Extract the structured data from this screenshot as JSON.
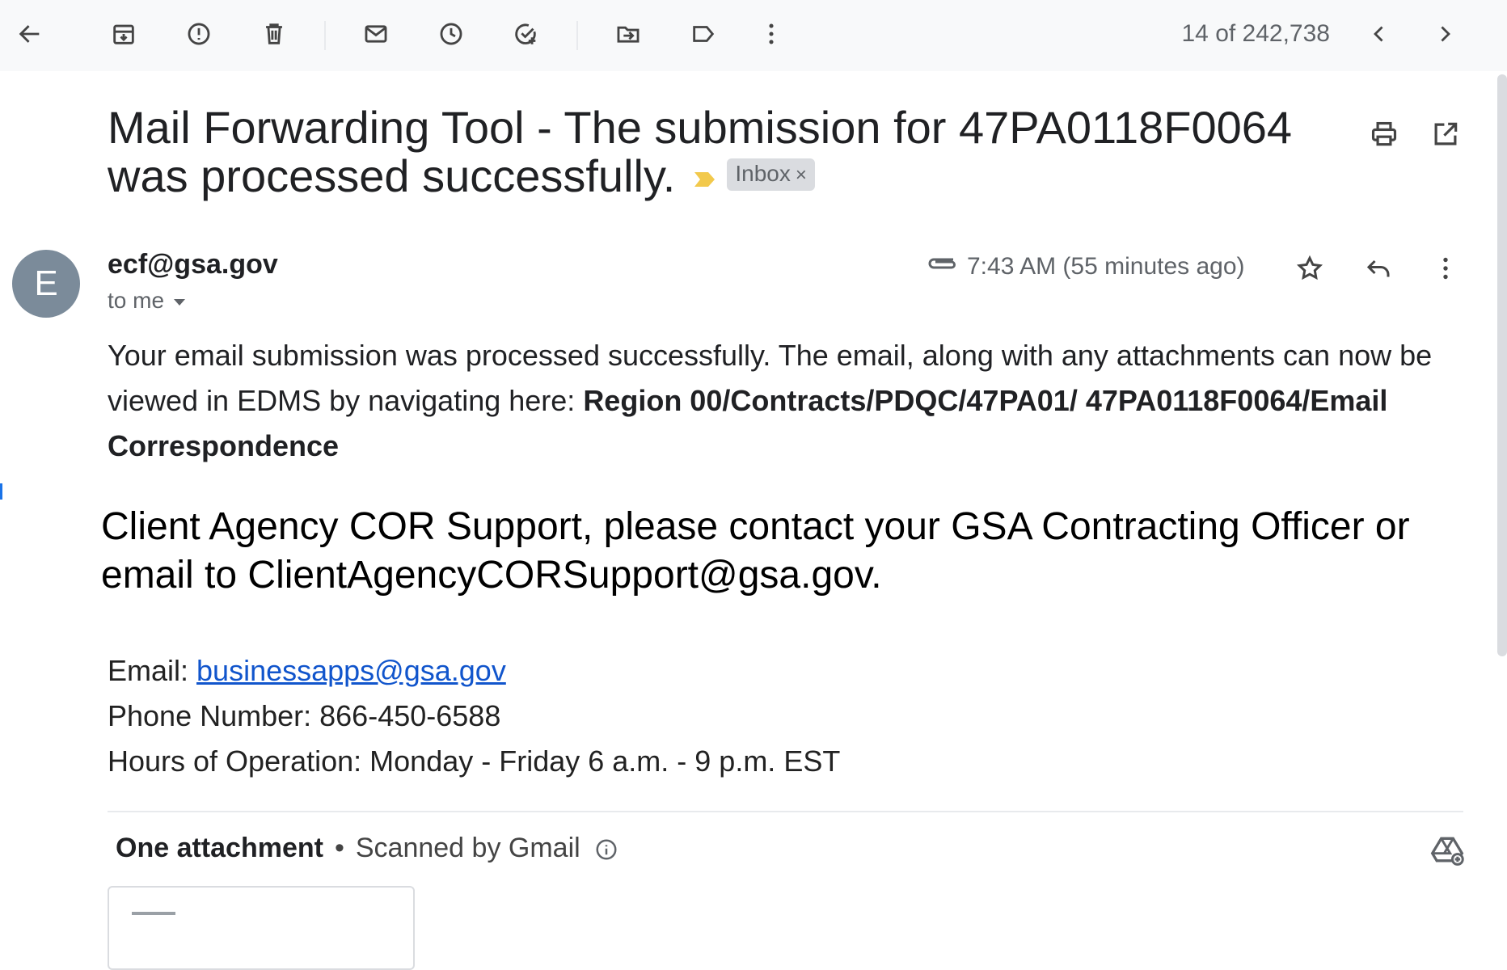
{
  "toolbar": {
    "icons": [
      "back-arrow-icon",
      "archive-icon",
      "report-spam-icon",
      "delete-icon",
      "mark-unread-icon",
      "snooze-icon",
      "add-to-tasks-icon",
      "move-to-icon",
      "label-icon",
      "more-vert-icon"
    ],
    "counter": "14 of 242,738",
    "prev_icon": "chevron-left-icon",
    "next_icon": "chevron-right-icon"
  },
  "message": {
    "subject": "Mail Forwarding Tool - The submission for 47PA0118F0064 was processed successfully.",
    "label_chip": "Inbox",
    "label_chip_close": "×",
    "sender": "ecf@gsa.gov",
    "avatar_letter": "E",
    "recipient": "to me",
    "time": "7:43 AM (55 minutes ago)",
    "body_intro": "Your email submission was processed successfully. The email, along with any attachments can now be viewed in EDMS by navigating here: ",
    "body_path": "Region 00/Contracts/PDQC/47PA01/ 47PA0118F0064/Email Correspondence",
    "notice": "Client Agency COR Support, please contact your GSA Contracting Officer or email to ClientAgencyCORSupport@gsa.gov.",
    "email_label": "Email: ",
    "email_link": "businessapps@gsa.gov",
    "phone": "Phone Number: 866-450-6588",
    "hours": "Hours of Operation: Monday - Friday 6 a.m. - 9 p.m. EST"
  },
  "attachments": {
    "heading": "One attachment",
    "separator": "•",
    "scanned": "Scanned by Gmail"
  },
  "colors": {
    "toolbar_bg": "#f8f9fa",
    "link": "#1155cc",
    "importance_marker": "#f2c94c",
    "avatar": "#7b8b9a"
  }
}
